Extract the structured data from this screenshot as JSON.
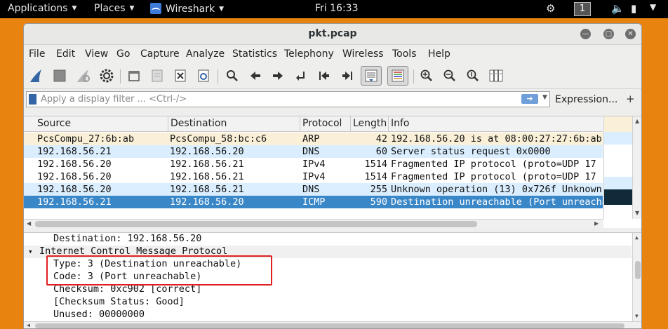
{
  "topbar": {
    "applications": "Applications",
    "places": "Places",
    "app_name": "Wireshark",
    "clock": "Fri 16:33",
    "workspace": "1"
  },
  "window": {
    "title": "pkt.pcap"
  },
  "menu": [
    "File",
    "Edit",
    "View",
    "Go",
    "Capture",
    "Analyze",
    "Statistics",
    "Telephony",
    "Wireless",
    "Tools",
    "Help"
  ],
  "toolbar_icons": [
    "shark-fin-start-icon",
    "stop-square-icon",
    "restart-fin-icon",
    "gear-options-icon",
    "open-folder-icon",
    "save-file-icon",
    "close-file-icon",
    "reload-icon",
    "search-icon",
    "back-arrow-icon",
    "forward-arrow-icon",
    "goto-packet-icon",
    "first-packet-icon",
    "last-packet-icon",
    "autoscroll-icon",
    "colorize-icon",
    "zoom-in-icon",
    "zoom-out-icon",
    "zoom-reset-icon",
    "resize-columns-icon"
  ],
  "filter": {
    "placeholder": "Apply a display filter ... <Ctrl-/>",
    "expression_label": "Expression...",
    "add_label": "+"
  },
  "packet_list": {
    "columns": [
      "Source",
      "Destination",
      "Protocol",
      "Length",
      "Info"
    ],
    "rows": [
      {
        "source": "PcsCompu_27:6b:ab",
        "destination": "PcsCompu_58:bc:c6",
        "protocol": "ARP",
        "length": "42",
        "info": "192.168.56.20 is at 08:00:27:27:6b:ab",
        "bg": "#faf0d7",
        "fg": "#111111"
      },
      {
        "source": "192.168.56.21",
        "destination": "192.168.56.20",
        "protocol": "DNS",
        "length": "60",
        "info": "Server status request 0x0000",
        "bg": "#daeeff",
        "fg": "#111111"
      },
      {
        "source": "192.168.56.20",
        "destination": "192.168.56.21",
        "protocol": "IPv4",
        "length": "1514",
        "info": "Fragmented IP protocol (proto=UDP 17",
        "bg": "#ffffff",
        "fg": "#111111"
      },
      {
        "source": "192.168.56.20",
        "destination": "192.168.56.21",
        "protocol": "IPv4",
        "length": "1514",
        "info": "Fragmented IP protocol (proto=UDP 17",
        "bg": "#ffffff",
        "fg": "#111111"
      },
      {
        "source": "192.168.56.20",
        "destination": "192.168.56.21",
        "protocol": "DNS",
        "length": "255",
        "info": "Unknown operation (13) 0x726f Unknown",
        "bg": "#daeeff",
        "fg": "#111111"
      },
      {
        "source": "192.168.56.21",
        "destination": "192.168.56.20",
        "protocol": "ICMP",
        "length": "590",
        "info": "Destination unreachable (Port unreachable)",
        "bg": "#3a87c8",
        "fg": "#ffffff"
      }
    ]
  },
  "details": {
    "lines": [
      {
        "text": "Destination: 192.168.56.20",
        "indent": 1,
        "expander": "",
        "bg": "#ffffff"
      },
      {
        "text": "Internet Control Message Protocol",
        "indent": 0,
        "expander": "▾",
        "bg": "#f0f0f0"
      },
      {
        "text": "Type: 3 (Destination unreachable)",
        "indent": 1,
        "expander": "",
        "bg": "#ffffff"
      },
      {
        "text": "Code: 3 (Port unreachable)",
        "indent": 1,
        "expander": "",
        "bg": "#ffffff"
      },
      {
        "text": "Checksum: 0xc902 [correct]",
        "indent": 1,
        "expander": "",
        "bg": "#ffffff"
      },
      {
        "text": "[Checksum Status: Good]",
        "indent": 1,
        "expander": "",
        "bg": "#ffffff"
      },
      {
        "text": "Unused: 00000000",
        "indent": 1,
        "expander": "",
        "bg": "#ffffff"
      }
    ]
  },
  "colors": {
    "desktop": "#e8830f",
    "selected_row": "#3a87c8",
    "highlight_box": "#e02020"
  }
}
